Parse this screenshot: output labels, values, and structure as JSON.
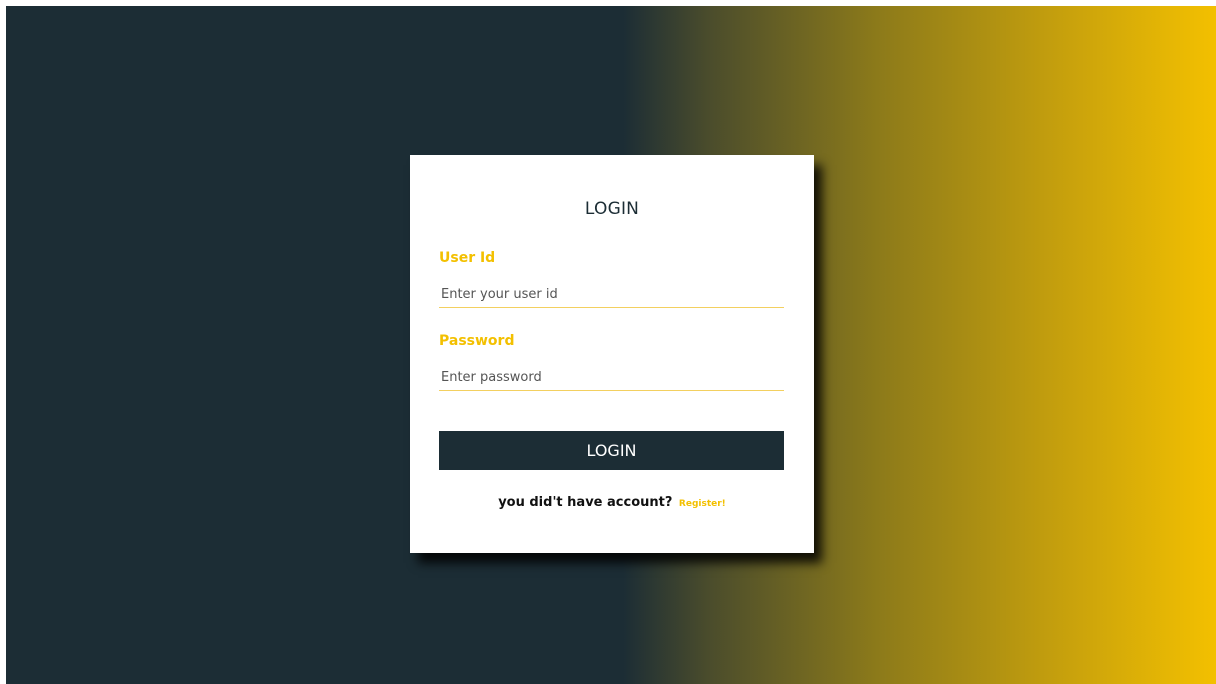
{
  "colors": {
    "primary_dark": "#1c2d35",
    "accent": "#f3c000",
    "card_background": "#ffffff"
  },
  "login_form": {
    "title": "LOGIN",
    "user_id": {
      "label": "User Id",
      "placeholder": "Enter your user id"
    },
    "password": {
      "label": "Password",
      "placeholder": "Enter password"
    },
    "submit_label": "LOGIN",
    "register_prompt": "you did't have account?",
    "register_link": "Register!"
  }
}
